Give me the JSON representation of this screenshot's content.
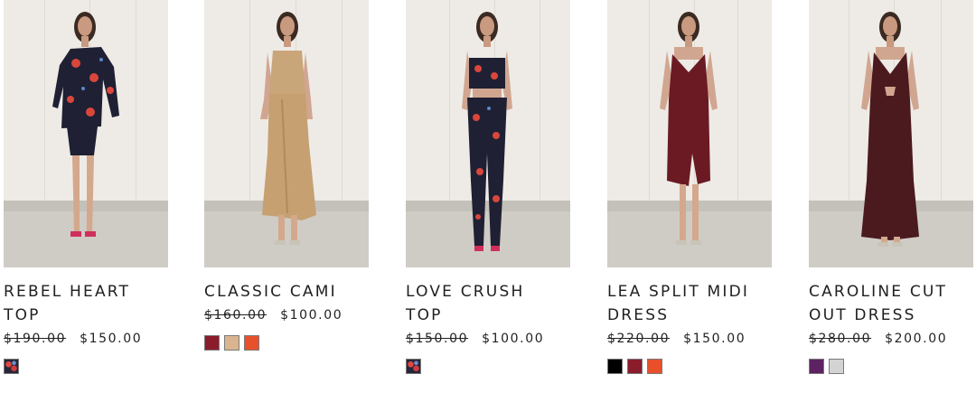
{
  "products": [
    {
      "name": "REBEL HEART TOP",
      "name_lines": [
        "REBEL HEART",
        "TOP"
      ],
      "old_price": "$190.00",
      "price": "$150.00",
      "swatches": [
        "floral-navy"
      ]
    },
    {
      "name": "CLASSIC CAMI",
      "name_lines": [
        "CLASSIC CAMI"
      ],
      "old_price": "$160.00",
      "price": "$100.00",
      "swatches": [
        "#8b1c2b",
        "#d9b48f",
        "#e8502c"
      ]
    },
    {
      "name": "LOVE CRUSH TOP",
      "name_lines": [
        "LOVE CRUSH",
        "TOP"
      ],
      "old_price": "$150.00",
      "price": "$100.00",
      "swatches": [
        "floral-navy"
      ]
    },
    {
      "name": "LEA SPLIT MIDI DRESS",
      "name_lines": [
        "LEA SPLIT MIDI",
        "DRESS"
      ],
      "old_price": "$220.00",
      "price": "$150.00",
      "swatches": [
        "#000000",
        "#8b1c2b",
        "#e8502c"
      ]
    },
    {
      "name": "CAROLINE CUT OUT DRESS",
      "name_lines": [
        "CAROLINE CUT",
        "OUT DRESS"
      ],
      "old_price": "$280.00",
      "price": "$200.00",
      "swatches": [
        "#5c2262",
        "#d3d3d3"
      ]
    }
  ]
}
